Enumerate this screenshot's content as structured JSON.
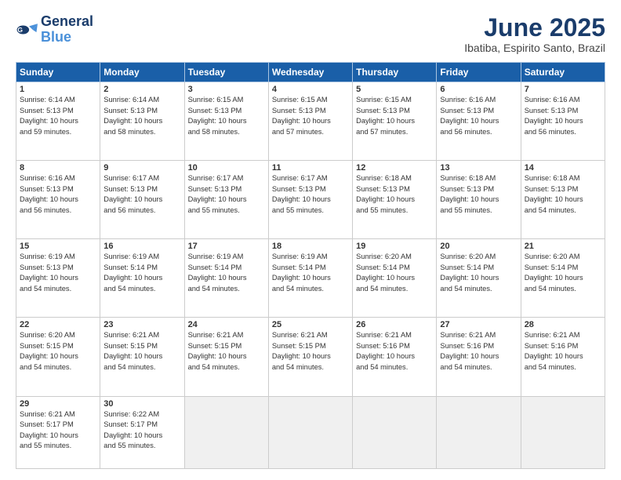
{
  "header": {
    "logo_line1": "General",
    "logo_line2": "Blue",
    "month": "June 2025",
    "location": "Ibatiba, Espirito Santo, Brazil"
  },
  "weekdays": [
    "Sunday",
    "Monday",
    "Tuesday",
    "Wednesday",
    "Thursday",
    "Friday",
    "Saturday"
  ],
  "weeks": [
    [
      {
        "day": "1",
        "info": "Sunrise: 6:14 AM\nSunset: 5:13 PM\nDaylight: 10 hours\nand 59 minutes."
      },
      {
        "day": "2",
        "info": "Sunrise: 6:14 AM\nSunset: 5:13 PM\nDaylight: 10 hours\nand 58 minutes."
      },
      {
        "day": "3",
        "info": "Sunrise: 6:15 AM\nSunset: 5:13 PM\nDaylight: 10 hours\nand 58 minutes."
      },
      {
        "day": "4",
        "info": "Sunrise: 6:15 AM\nSunset: 5:13 PM\nDaylight: 10 hours\nand 57 minutes."
      },
      {
        "day": "5",
        "info": "Sunrise: 6:15 AM\nSunset: 5:13 PM\nDaylight: 10 hours\nand 57 minutes."
      },
      {
        "day": "6",
        "info": "Sunrise: 6:16 AM\nSunset: 5:13 PM\nDaylight: 10 hours\nand 56 minutes."
      },
      {
        "day": "7",
        "info": "Sunrise: 6:16 AM\nSunset: 5:13 PM\nDaylight: 10 hours\nand 56 minutes."
      }
    ],
    [
      {
        "day": "8",
        "info": "Sunrise: 6:16 AM\nSunset: 5:13 PM\nDaylight: 10 hours\nand 56 minutes."
      },
      {
        "day": "9",
        "info": "Sunrise: 6:17 AM\nSunset: 5:13 PM\nDaylight: 10 hours\nand 56 minutes."
      },
      {
        "day": "10",
        "info": "Sunrise: 6:17 AM\nSunset: 5:13 PM\nDaylight: 10 hours\nand 55 minutes."
      },
      {
        "day": "11",
        "info": "Sunrise: 6:17 AM\nSunset: 5:13 PM\nDaylight: 10 hours\nand 55 minutes."
      },
      {
        "day": "12",
        "info": "Sunrise: 6:18 AM\nSunset: 5:13 PM\nDaylight: 10 hours\nand 55 minutes."
      },
      {
        "day": "13",
        "info": "Sunrise: 6:18 AM\nSunset: 5:13 PM\nDaylight: 10 hours\nand 55 minutes."
      },
      {
        "day": "14",
        "info": "Sunrise: 6:18 AM\nSunset: 5:13 PM\nDaylight: 10 hours\nand 54 minutes."
      }
    ],
    [
      {
        "day": "15",
        "info": "Sunrise: 6:19 AM\nSunset: 5:13 PM\nDaylight: 10 hours\nand 54 minutes."
      },
      {
        "day": "16",
        "info": "Sunrise: 6:19 AM\nSunset: 5:14 PM\nDaylight: 10 hours\nand 54 minutes."
      },
      {
        "day": "17",
        "info": "Sunrise: 6:19 AM\nSunset: 5:14 PM\nDaylight: 10 hours\nand 54 minutes."
      },
      {
        "day": "18",
        "info": "Sunrise: 6:19 AM\nSunset: 5:14 PM\nDaylight: 10 hours\nand 54 minutes."
      },
      {
        "day": "19",
        "info": "Sunrise: 6:20 AM\nSunset: 5:14 PM\nDaylight: 10 hours\nand 54 minutes."
      },
      {
        "day": "20",
        "info": "Sunrise: 6:20 AM\nSunset: 5:14 PM\nDaylight: 10 hours\nand 54 minutes."
      },
      {
        "day": "21",
        "info": "Sunrise: 6:20 AM\nSunset: 5:14 PM\nDaylight: 10 hours\nand 54 minutes."
      }
    ],
    [
      {
        "day": "22",
        "info": "Sunrise: 6:20 AM\nSunset: 5:15 PM\nDaylight: 10 hours\nand 54 minutes."
      },
      {
        "day": "23",
        "info": "Sunrise: 6:21 AM\nSunset: 5:15 PM\nDaylight: 10 hours\nand 54 minutes."
      },
      {
        "day": "24",
        "info": "Sunrise: 6:21 AM\nSunset: 5:15 PM\nDaylight: 10 hours\nand 54 minutes."
      },
      {
        "day": "25",
        "info": "Sunrise: 6:21 AM\nSunset: 5:15 PM\nDaylight: 10 hours\nand 54 minutes."
      },
      {
        "day": "26",
        "info": "Sunrise: 6:21 AM\nSunset: 5:16 PM\nDaylight: 10 hours\nand 54 minutes."
      },
      {
        "day": "27",
        "info": "Sunrise: 6:21 AM\nSunset: 5:16 PM\nDaylight: 10 hours\nand 54 minutes."
      },
      {
        "day": "28",
        "info": "Sunrise: 6:21 AM\nSunset: 5:16 PM\nDaylight: 10 hours\nand 54 minutes."
      }
    ],
    [
      {
        "day": "29",
        "info": "Sunrise: 6:21 AM\nSunset: 5:17 PM\nDaylight: 10 hours\nand 55 minutes."
      },
      {
        "day": "30",
        "info": "Sunrise: 6:22 AM\nSunset: 5:17 PM\nDaylight: 10 hours\nand 55 minutes."
      },
      {
        "day": "",
        "info": ""
      },
      {
        "day": "",
        "info": ""
      },
      {
        "day": "",
        "info": ""
      },
      {
        "day": "",
        "info": ""
      },
      {
        "day": "",
        "info": ""
      }
    ]
  ]
}
